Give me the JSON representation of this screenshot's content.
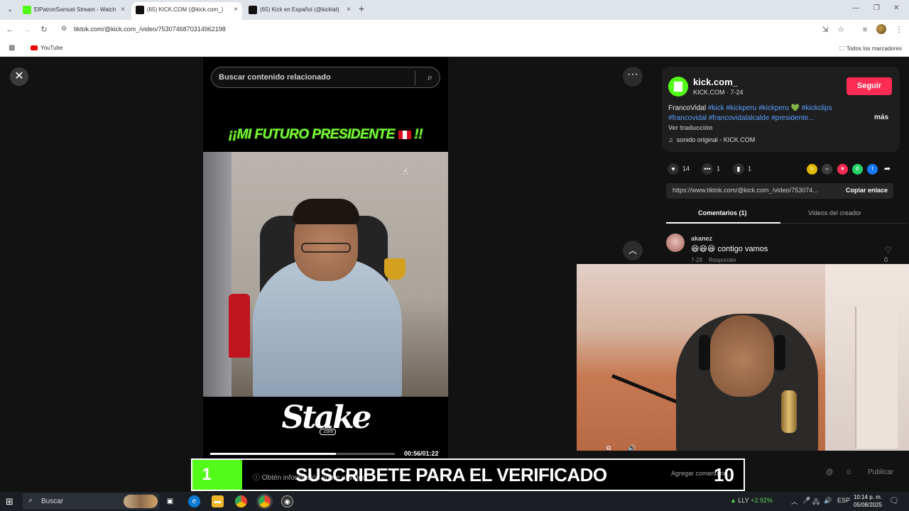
{
  "browser": {
    "tabs": [
      {
        "title": "ElPatronSamuel Stream - Watch",
        "close": "×"
      },
      {
        "title": "(65) KICK.COM (@kick.com_)",
        "close": "×"
      },
      {
        "title": "(65) Kick en Español (@kicklat)",
        "close": "×"
      }
    ],
    "new_tab": "+",
    "url": "tiktok.com/@kick.com_/video/7530746870314962198",
    "bookmarks": {
      "youtube": "YouTube",
      "all": "Todos los marcadores"
    }
  },
  "tiktok": {
    "search_placeholder": "Buscar contenido relacionado",
    "video_headline": "¡¡MI FUTURO PRESIDENTE",
    "video_headline_end": "!!",
    "stake_logo": "Stake",
    "stake_com": ".com",
    "progress": 0.68,
    "timecode": "00:56/01:22",
    "creator": {
      "name": "kick.com_",
      "subtitle": "KICK.COM · 7-24",
      "follow": "Seguir"
    },
    "description": {
      "prefix": "FrancoVidal",
      "tags1": "#kick #kickperu #kickperu",
      "heart": "💚",
      "tags2": "#kickclips",
      "tags3": "#francovidal #francovidalalcalde #presidente...",
      "more": "más",
      "translate": "Ver traducción"
    },
    "sound": "sonido original - KICK.COM",
    "stats": {
      "likes": "14",
      "comments": "1",
      "saves": "1"
    },
    "link": "https://www.tiktok.com/@kick.com_/video/753074...",
    "copy_link": "Copiar enlace",
    "tabs": {
      "comments": "Comentarios (1)",
      "creator_videos": "Videos del creador"
    },
    "comment": {
      "user": "akanez",
      "text": "😆😆😆 contigo vamos",
      "date": "7-28",
      "reply": "Responder",
      "likes": "0"
    },
    "add_comment": "Agregar comentario...",
    "post": "Publicar",
    "info_text": "Obtén información sobre el video"
  },
  "overlay": {
    "banner_num": "1",
    "banner_text": "SUSCRIBETE PARA EL VERIFICADO",
    "banner_count": "10"
  },
  "taskbar": {
    "search": "Buscar",
    "stock": "LLY",
    "stock_change": "+2.92%",
    "lang": "ESP",
    "time": "10:14 p. m.",
    "date": "05/08/2025"
  }
}
